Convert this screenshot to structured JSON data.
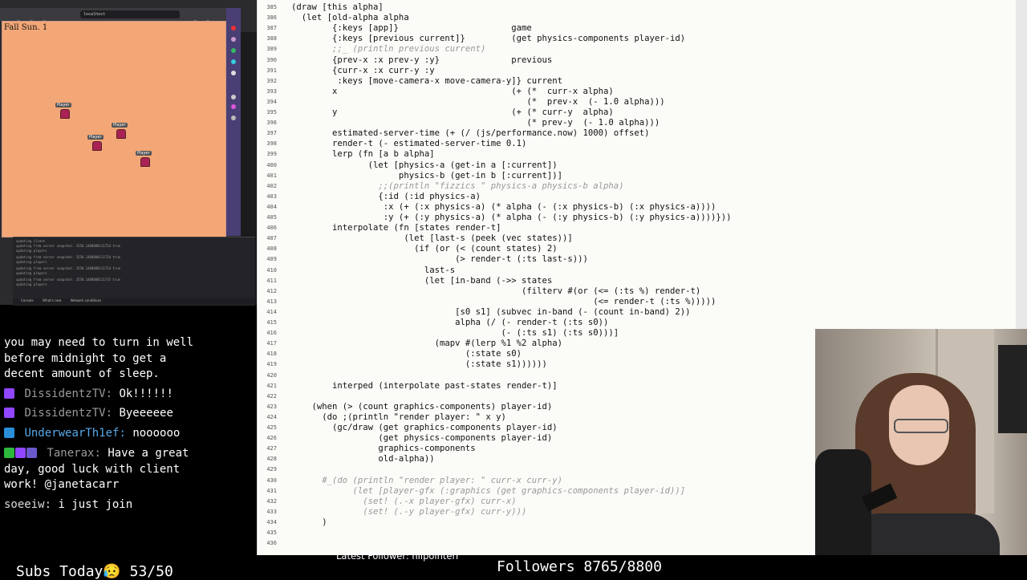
{
  "browser": {
    "url": "localhost",
    "game_date": "Fall Sun. 1",
    "player_label": "Player",
    "log_lines": [
      "updating client",
      "updating from server snapshot:  3550.1488880111734 true",
      "updating players",
      "updating from server snapshot:  3550.1488880111734 true",
      "updating players",
      "updating from server snapshot:  3550.1488880111734 true",
      "updating players",
      "updating from server snapshot:  3550.1488880111735 true",
      "updating players"
    ],
    "devtools_tabs": [
      "Console",
      "What's new",
      "Network conditions"
    ]
  },
  "chat": {
    "lines": [
      {
        "user": "",
        "message": "you may need to turn in well"
      },
      {
        "user": "",
        "message": "before midnight to get a"
      },
      {
        "user": "",
        "message": "decent amount of sleep."
      },
      {
        "user": "DissidentzTV:",
        "message": "Ok!!!!!!"
      },
      {
        "user": "DissidentzTV:",
        "message": "Byeeeeee"
      },
      {
        "user": "UnderwearTh1ef:",
        "message": "noooooo"
      },
      {
        "user": "Tanerax:",
        "message": "Have a great"
      },
      {
        "user": "",
        "message": "day, good luck with client"
      },
      {
        "user": "",
        "message": "work! @janetacarr"
      },
      {
        "user": "soeeiw:",
        "message": "i just join"
      }
    ]
  },
  "editor": {
    "lines": [
      {
        "n": "385",
        "t": "(draw [this alpha]",
        "cls": ""
      },
      {
        "n": "386",
        "t": "  (let [old-alpha alpha",
        "cls": ""
      },
      {
        "n": "387",
        "t": "        {:keys [app]}                      game",
        "cls": ""
      },
      {
        "n": "388",
        "t": "        {:keys [previous current]}         (get physics-components player-id)",
        "cls": ""
      },
      {
        "n": "389",
        "t": "        ;;_ (println previous current)",
        "cls": "cm"
      },
      {
        "n": "390",
        "t": "        {prev-x :x prev-y :y}              previous",
        "cls": ""
      },
      {
        "n": "391",
        "t": "        {curr-x :x curr-y :y",
        "cls": ""
      },
      {
        "n": "392",
        "t": "         :keys [move-camera-x move-camera-y]} current",
        "cls": ""
      },
      {
        "n": "393",
        "t": "        x                                  (+ (*  curr-x alpha)",
        "cls": ""
      },
      {
        "n": "394",
        "t": "                                              (*  prev-x  (- 1.0 alpha)))",
        "cls": ""
      },
      {
        "n": "395",
        "t": "        y                                  (+ (* curr-y  alpha)",
        "cls": ""
      },
      {
        "n": "396",
        "t": "                                              (* prev-y  (- 1.0 alpha)))",
        "cls": ""
      },
      {
        "n": "397",
        "t": "        estimated-server-time (+ (/ (js/performance.now) 1000) offset)",
        "cls": ""
      },
      {
        "n": "398",
        "t": "        render-t (- estimated-server-time 0.1)",
        "cls": ""
      },
      {
        "n": "399",
        "t": "        lerp (fn [a b alpha]",
        "cls": ""
      },
      {
        "n": "400",
        "t": "               (let [physics-a (get-in a [:current])",
        "cls": ""
      },
      {
        "n": "401",
        "t": "                     physics-b (get-in b [:current])]",
        "cls": ""
      },
      {
        "n": "402",
        "t": "                 ;;(println \"fizzics \" physics-a physics-b alpha)",
        "cls": "cm"
      },
      {
        "n": "403",
        "t": "                 {:id (:id physics-a)",
        "cls": ""
      },
      {
        "n": "404",
        "t": "                  :x (+ (:x physics-a) (* alpha (- (:x physics-b) (:x physics-a))))",
        "cls": ""
      },
      {
        "n": "405",
        "t": "                  :y (+ (:y physics-a) (* alpha (- (:y physics-b) (:y physics-a))))}))",
        "cls": ""
      },
      {
        "n": "406",
        "t": "        interpolate (fn [states render-t]",
        "cls": ""
      },
      {
        "n": "407",
        "t": "                      (let [last-s (peek (vec states))]",
        "cls": ""
      },
      {
        "n": "408",
        "t": "                        (if (or (< (count states) 2)",
        "cls": ""
      },
      {
        "n": "409",
        "t": "                                (> render-t (:ts last-s)))",
        "cls": ""
      },
      {
        "n": "410",
        "t": "                          last-s",
        "cls": ""
      },
      {
        "n": "411",
        "t": "                          (let [in-band (->> states",
        "cls": ""
      },
      {
        "n": "412",
        "t": "                                             (filterv #(or (<= (:ts %) render-t)",
        "cls": ""
      },
      {
        "n": "413",
        "t": "                                                           (<= render-t (:ts %)))))",
        "cls": ""
      },
      {
        "n": "414",
        "t": "                                [s0 s1] (subvec in-band (- (count in-band) 2))",
        "cls": ""
      },
      {
        "n": "415",
        "t": "                                alpha (/ (- render-t (:ts s0))",
        "cls": ""
      },
      {
        "n": "416",
        "t": "                                         (- (:ts s1) (:ts s0)))]",
        "cls": ""
      },
      {
        "n": "417",
        "t": "                            (mapv #(lerp %1 %2 alpha)",
        "cls": ""
      },
      {
        "n": "418",
        "t": "                                  (:state s0)",
        "cls": ""
      },
      {
        "n": "419",
        "t": "                                  (:state s1))))))",
        "cls": ""
      },
      {
        "n": "420",
        "t": "",
        "cls": ""
      },
      {
        "n": "421",
        "t": "        interped (interpolate past-states render-t)]",
        "cls": ""
      },
      {
        "n": "422",
        "t": "",
        "cls": ""
      },
      {
        "n": "423",
        "t": "    (when (> (count graphics-components) player-id)",
        "cls": ""
      },
      {
        "n": "424",
        "t": "      (do ;(println \"render player: \" x y)",
        "cls": ""
      },
      {
        "n": "425",
        "t": "        (gc/draw (get graphics-components player-id)",
        "cls": ""
      },
      {
        "n": "426",
        "t": "                 (get physics-components player-id)",
        "cls": ""
      },
      {
        "n": "427",
        "t": "                 graphics-components",
        "cls": ""
      },
      {
        "n": "428",
        "t": "                 old-alpha))",
        "cls": ""
      },
      {
        "n": "429",
        "t": "",
        "cls": ""
      },
      {
        "n": "430",
        "t": "      #_(do (println \"render player: \" curr-x curr-y)",
        "cls": "cm"
      },
      {
        "n": "431",
        "t": "            (let [player-gfx (:graphics (get graphics-components player-id))]",
        "cls": "cm"
      },
      {
        "n": "432",
        "t": "              (set! (.-x player-gfx) curr-x)",
        "cls": "cm"
      },
      {
        "n": "433",
        "t": "              (set! (.-y player-gfx) curr-y)))",
        "cls": "cm"
      },
      {
        "n": "434",
        "t": "      )",
        "cls": ""
      },
      {
        "n": "435",
        "t": "",
        "cls": ""
      },
      {
        "n": "436",
        "t": "",
        "cls": ""
      }
    ]
  },
  "overlay": {
    "subs_today": "Subs Today😥 53/50",
    "latest_follower": "Latest Follower: nilpointerr",
    "followers": "Followers 8765/8800"
  },
  "colors": {
    "game_bg": "#f3a777",
    "browser_sidebar": "#4a3f75",
    "chat_username": "#9a9a9a",
    "underwear_user": "#58a8e8",
    "comment": "#999999"
  }
}
